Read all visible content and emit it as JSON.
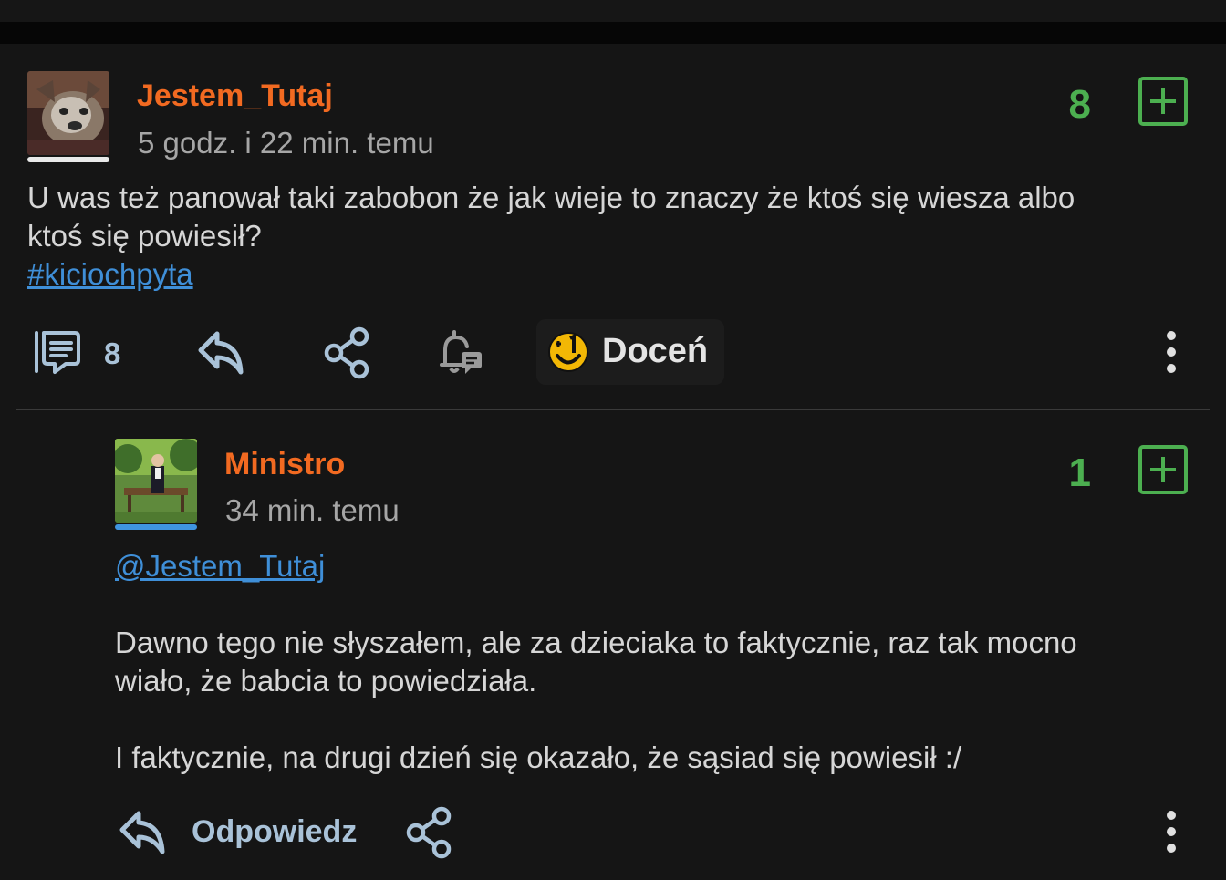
{
  "posts": [
    {
      "username": "Jestem_Tutaj",
      "timestamp": "5 godz. i 22 min. temu",
      "score": "8",
      "body_line1": "U was też panował taki zabobon że jak wieje to znaczy że ktoś się wiesza albo",
      "body_line2": "ktoś się powiesił?",
      "tag": "#kiciochpyta",
      "comments_count": "8",
      "docen_label": "Doceń",
      "avatar_bar_color": "#e9e9e9"
    },
    {
      "username": "Ministro",
      "timestamp": "34 min. temu",
      "score": "1",
      "mention": "@Jestem_Tutaj",
      "body_line1": "Dawno tego nie słyszałem, ale za dzieciaka to faktycznie, raz tak mocno",
      "body_line2": "wiało, że babcia to powiedziała.",
      "body_line3": "I faktycznie, na drugi dzień się okazało, że sąsiad się powiesił :/",
      "reply_label": "Odpowiedz",
      "avatar_bar_color": "#3f95e0"
    }
  ],
  "icons": {
    "comments": "comments-icon",
    "reply": "reply-arrow-icon",
    "share": "share-icon",
    "notify": "bell-notification-icon",
    "docen": "plus-one-smiley-icon",
    "more": "more-vertical-icon",
    "plus": "plus-square-icon"
  },
  "colors": {
    "background": "#151515",
    "username": "#f26a21",
    "score": "#4caf50",
    "link": "#3f8fd8",
    "action": "#a9c2d8"
  }
}
